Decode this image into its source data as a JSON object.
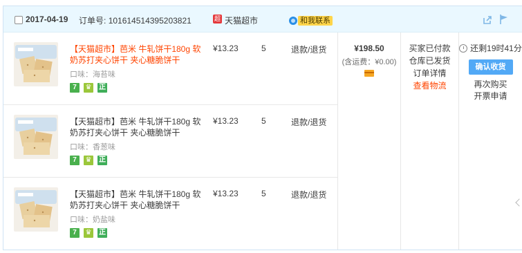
{
  "header": {
    "date": "2017-04-19",
    "order_label": "订单号:",
    "order_number": "101614514395203821",
    "shop_icon_text": "超",
    "shop_name": "天猫超市",
    "contact_label": "和我联系"
  },
  "items": [
    {
      "title": "【天猫超市】芭米 牛轧饼干180g 软奶苏打夹心饼干 夹心糖脆饼干",
      "title_highlighted": true,
      "flavor": "口味：海苔味",
      "price": "¥13.23",
      "qty": "5",
      "refund": "退款/退货"
    },
    {
      "title": "【天猫超市】芭米 牛轧饼干180g 软奶苏打夹心饼干 夹心糖脆饼干",
      "title_highlighted": false,
      "flavor": "口味：香葱味",
      "price": "¥13.23",
      "qty": "5",
      "refund": "退款/退货"
    },
    {
      "title": "【天猫超市】芭米 牛轧饼干180g 软奶苏打夹心饼干 夹心糖脆饼干",
      "title_highlighted": false,
      "flavor": "口味：奶盐味",
      "price": "¥13.23",
      "qty": "5",
      "refund": "退款/退货"
    }
  ],
  "badges": {
    "seven": "7",
    "shield": "♛",
    "genuine": "正"
  },
  "summary": {
    "total": "¥198.50",
    "shipping": "(含运费：¥0.00)"
  },
  "status": {
    "line1": "买家已付款",
    "line2": "仓库已发货",
    "detail_link": "订单详情",
    "logistics_link": "查看物流"
  },
  "actions": {
    "countdown": "还剩19时41分",
    "confirm_button": "确认收货",
    "rebuy": "再次购买",
    "invoice": "开票申请"
  },
  "colors": {
    "header_bg": "#eaf8ff",
    "accent_red": "#ff4400",
    "button_blue": "#52a9f6"
  }
}
